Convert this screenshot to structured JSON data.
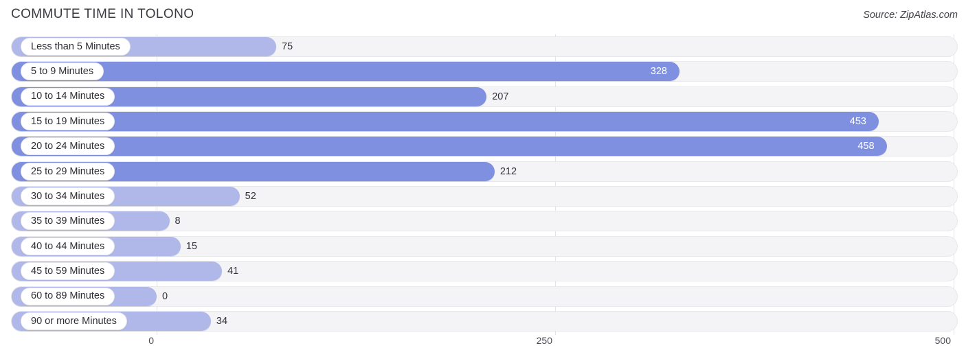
{
  "header": {
    "title": "COMMUTE TIME IN TOLONO",
    "source": "Source: ZipAtlas.com"
  },
  "axis": {
    "ticks": [
      {
        "label": "0",
        "value": 0
      },
      {
        "label": "250",
        "value": 250
      },
      {
        "label": "500",
        "value": 500
      }
    ]
  },
  "colors": {
    "bar_light": "#b0b8ea",
    "bar_dark": "#8090e0",
    "track": "#f4f4f6",
    "gridline": "#e2e2e6",
    "label_text": "#2f2f36",
    "value_text_outside": "#33333a",
    "value_text_inside": "#ffffff"
  },
  "chart_data": {
    "type": "bar",
    "orientation": "horizontal",
    "title": "COMMUTE TIME IN TOLONO",
    "xlabel": "",
    "ylabel": "",
    "xlim": [
      0,
      500
    ],
    "grid": true,
    "legend": false,
    "categories": [
      "Less than 5 Minutes",
      "5 to 9 Minutes",
      "10 to 14 Minutes",
      "15 to 19 Minutes",
      "20 to 24 Minutes",
      "25 to 29 Minutes",
      "30 to 34 Minutes",
      "35 to 39 Minutes",
      "40 to 44 Minutes",
      "45 to 59 Minutes",
      "60 to 89 Minutes",
      "90 or more Minutes"
    ],
    "values": [
      75,
      328,
      207,
      453,
      458,
      212,
      52,
      8,
      15,
      41,
      0,
      34
    ],
    "value_labels": [
      "75",
      "328",
      "207",
      "453",
      "458",
      "212",
      "52",
      "8",
      "15",
      "41",
      "0",
      "34"
    ]
  },
  "rows": [
    {
      "label": "Less than 5 Minutes",
      "value": 75,
      "value_label": "75",
      "inside": false,
      "shade": "light"
    },
    {
      "label": "5 to 9 Minutes",
      "value": 328,
      "value_label": "328",
      "inside": true,
      "shade": "dark"
    },
    {
      "label": "10 to 14 Minutes",
      "value": 207,
      "value_label": "207",
      "inside": false,
      "shade": "dark"
    },
    {
      "label": "15 to 19 Minutes",
      "value": 453,
      "value_label": "453",
      "inside": true,
      "shade": "dark"
    },
    {
      "label": "20 to 24 Minutes",
      "value": 458,
      "value_label": "458",
      "inside": true,
      "shade": "dark"
    },
    {
      "label": "25 to 29 Minutes",
      "value": 212,
      "value_label": "212",
      "inside": false,
      "shade": "dark"
    },
    {
      "label": "30 to 34 Minutes",
      "value": 52,
      "value_label": "52",
      "inside": false,
      "shade": "light"
    },
    {
      "label": "35 to 39 Minutes",
      "value": 8,
      "value_label": "8",
      "inside": false,
      "shade": "light"
    },
    {
      "label": "40 to 44 Minutes",
      "value": 15,
      "value_label": "15",
      "inside": false,
      "shade": "light"
    },
    {
      "label": "45 to 59 Minutes",
      "value": 41,
      "value_label": "41",
      "inside": false,
      "shade": "light"
    },
    {
      "label": "60 to 89 Minutes",
      "value": 0,
      "value_label": "0",
      "inside": false,
      "shade": "light"
    },
    {
      "label": "90 or more Minutes",
      "value": 34,
      "value_label": "34",
      "inside": false,
      "shade": "light"
    }
  ]
}
